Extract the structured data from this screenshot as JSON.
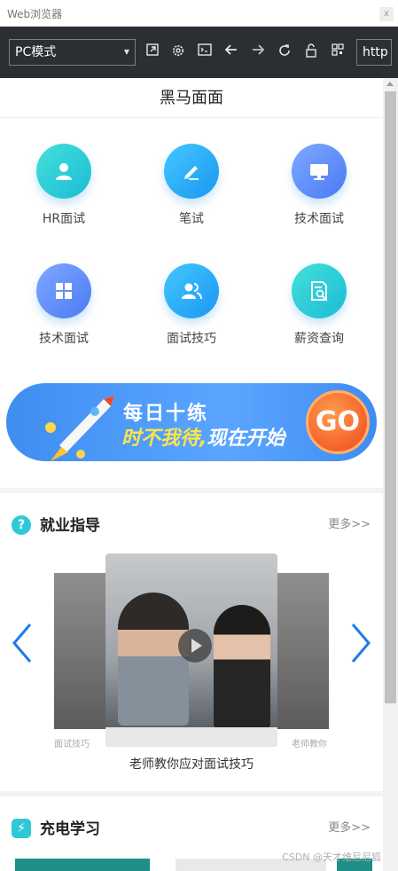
{
  "window": {
    "title": "Web浏览器",
    "close_label": "x"
  },
  "toolbar": {
    "mode": "PC模式",
    "url_value": "http",
    "icons": [
      "open-external-icon",
      "settings-gear-icon",
      "terminal-icon",
      "back-arrow-icon",
      "forward-arrow-icon",
      "refresh-icon",
      "lock-icon",
      "qr-code-icon"
    ]
  },
  "page": {
    "title": "黑马面面"
  },
  "categories": [
    {
      "label": "HR面试",
      "icon": "user-icon"
    },
    {
      "label": "笔试",
      "icon": "pencil-icon"
    },
    {
      "label": "技术面试",
      "icon": "monitor-icon"
    },
    {
      "label": "技术面试",
      "icon": "grid-blocks-icon"
    },
    {
      "label": "面试技巧",
      "icon": "users-icon"
    },
    {
      "label": "薪资查询",
      "icon": "document-search-icon"
    }
  ],
  "banner": {
    "line1": "每日十练",
    "line2a": "时不我待,",
    "line2b": "现在开始",
    "button": "GO"
  },
  "career": {
    "badge": "?",
    "heading": "就业指导",
    "more": "更多>>",
    "slides": [
      {
        "caption": "面试技巧"
      },
      {
        "caption": "老师教你应对面试技巧"
      },
      {
        "caption": "老师教你"
      }
    ]
  },
  "study": {
    "badge": "⚡",
    "heading": "充电学习",
    "more": "更多>>"
  },
  "watermark": "CSDN @天才维尼尼狐",
  "colors": {
    "toolbar_bg": "#2b2e33",
    "teal": "#2fc9d6",
    "blue": "#1a97f2",
    "arrow_blue": "#1f7be8",
    "go_orange": "#f0481f"
  }
}
